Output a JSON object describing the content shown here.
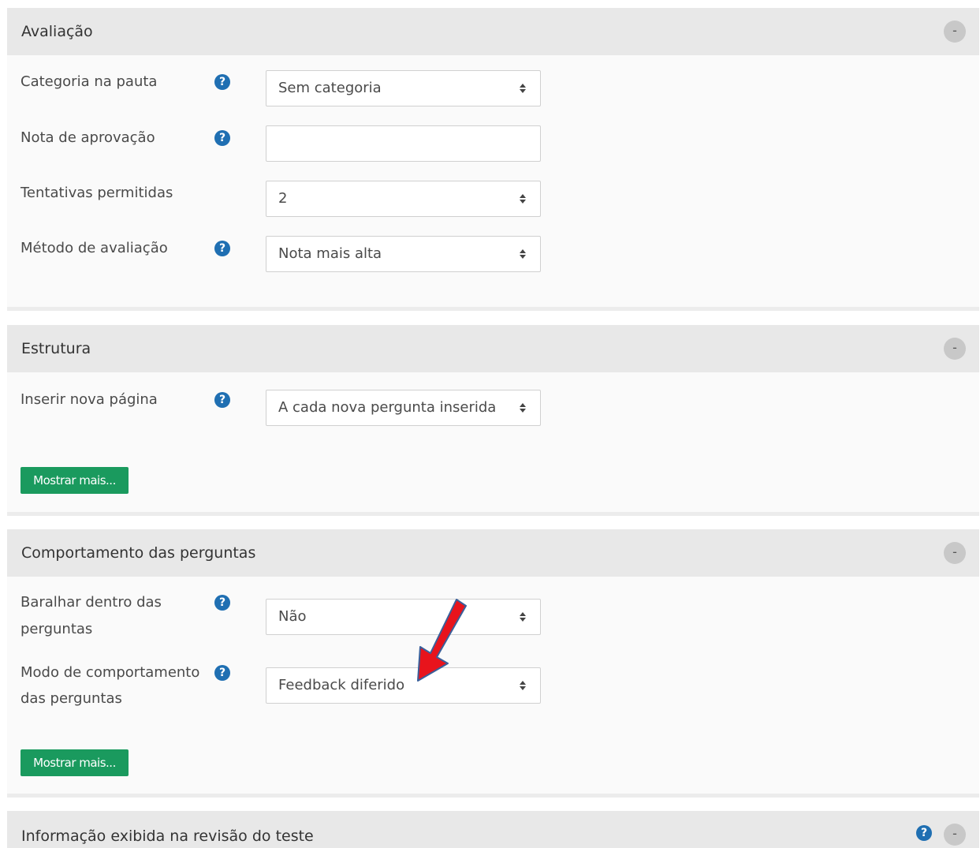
{
  "sections": {
    "avaliacao": {
      "title": "Avaliação",
      "collapse_label": "-",
      "rows": {
        "categoria": {
          "label": "Categoria na pauta",
          "value": "Sem categoria"
        },
        "nota": {
          "label": "Nota de aprovação",
          "value": ""
        },
        "tentativas": {
          "label": "Tentativas permitidas",
          "value": "2"
        },
        "metodo": {
          "label": "Método de avaliação",
          "value": "Nota mais alta"
        }
      }
    },
    "estrutura": {
      "title": "Estrutura",
      "collapse_label": "-",
      "rows": {
        "inserir": {
          "label": "Inserir nova página",
          "value": "A cada nova pergunta inserida"
        }
      },
      "more_button": "Mostrar mais..."
    },
    "comportamento": {
      "title": "Comportamento das perguntas",
      "collapse_label": "-",
      "rows": {
        "baralhar": {
          "label_line1": "Baralhar dentro das",
          "label_line2": "perguntas",
          "value": "Não"
        },
        "modo": {
          "label_line1": "Modo de comportamento",
          "label_line2": "das perguntas",
          "value": "Feedback diferido"
        }
      },
      "more_button": "Mostrar mais..."
    },
    "informacao": {
      "title": "Informação exibida na revisão do teste",
      "collapse_label": "-"
    }
  },
  "help_glyph": "?",
  "colors": {
    "help_icon": "#1f6fb2",
    "more_button": "#1a9a5e",
    "annotation_arrow": "#e8141c"
  }
}
